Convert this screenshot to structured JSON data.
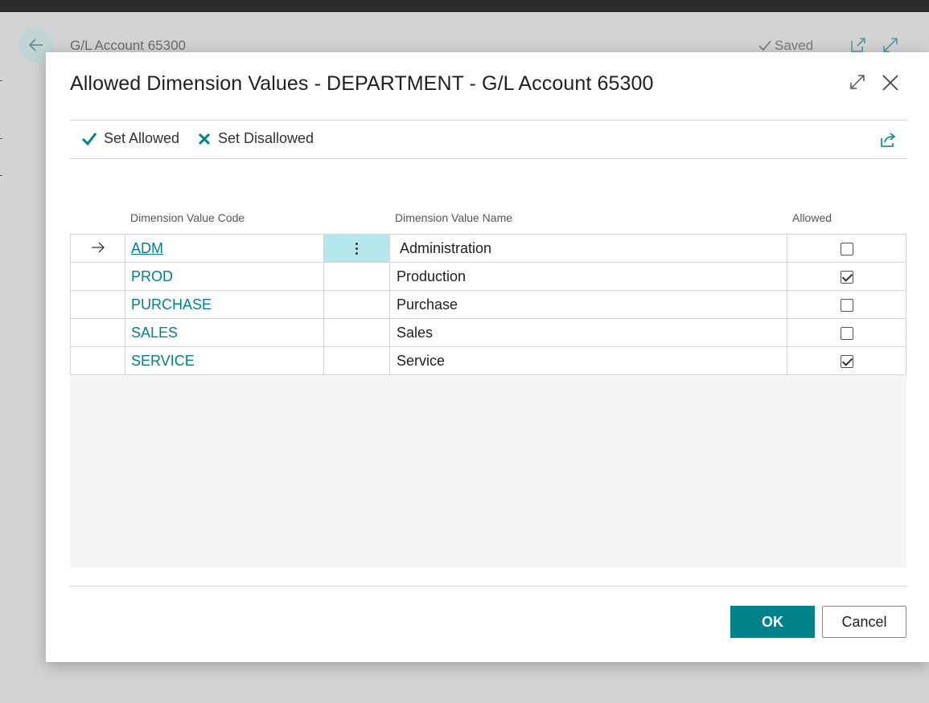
{
  "background": {
    "page_title": "G/L Account 65300",
    "saved_label": "Saved"
  },
  "dialog": {
    "title": "Allowed Dimension Values - DEPARTMENT - G/L Account 65300",
    "actions": {
      "set_allowed": "Set Allowed",
      "set_disallowed": "Set Disallowed"
    },
    "columns": {
      "code": "Dimension Value Code",
      "name": "Dimension Value Name",
      "allowed": "Allowed"
    },
    "rows": [
      {
        "code": "ADM",
        "name": "Administration",
        "allowed": false,
        "current": true
      },
      {
        "code": "PROD",
        "name": "Production",
        "allowed": true,
        "current": false
      },
      {
        "code": "PURCHASE",
        "name": "Purchase",
        "allowed": false,
        "current": false
      },
      {
        "code": "SALES",
        "name": "Sales",
        "allowed": false,
        "current": false
      },
      {
        "code": "SERVICE",
        "name": "Service",
        "allowed": true,
        "current": false
      }
    ],
    "ok_label": "OK",
    "cancel_label": "Cancel"
  },
  "colors": {
    "accent": "#00828a",
    "active_cell": "#b4e7ec"
  },
  "icons": [
    "back-arrow-icon",
    "checkmark-icon",
    "open-new-window-icon",
    "expand-icon",
    "close-icon",
    "check-icon",
    "x-icon",
    "share-icon",
    "row-arrow-icon",
    "more-options-icon"
  ]
}
